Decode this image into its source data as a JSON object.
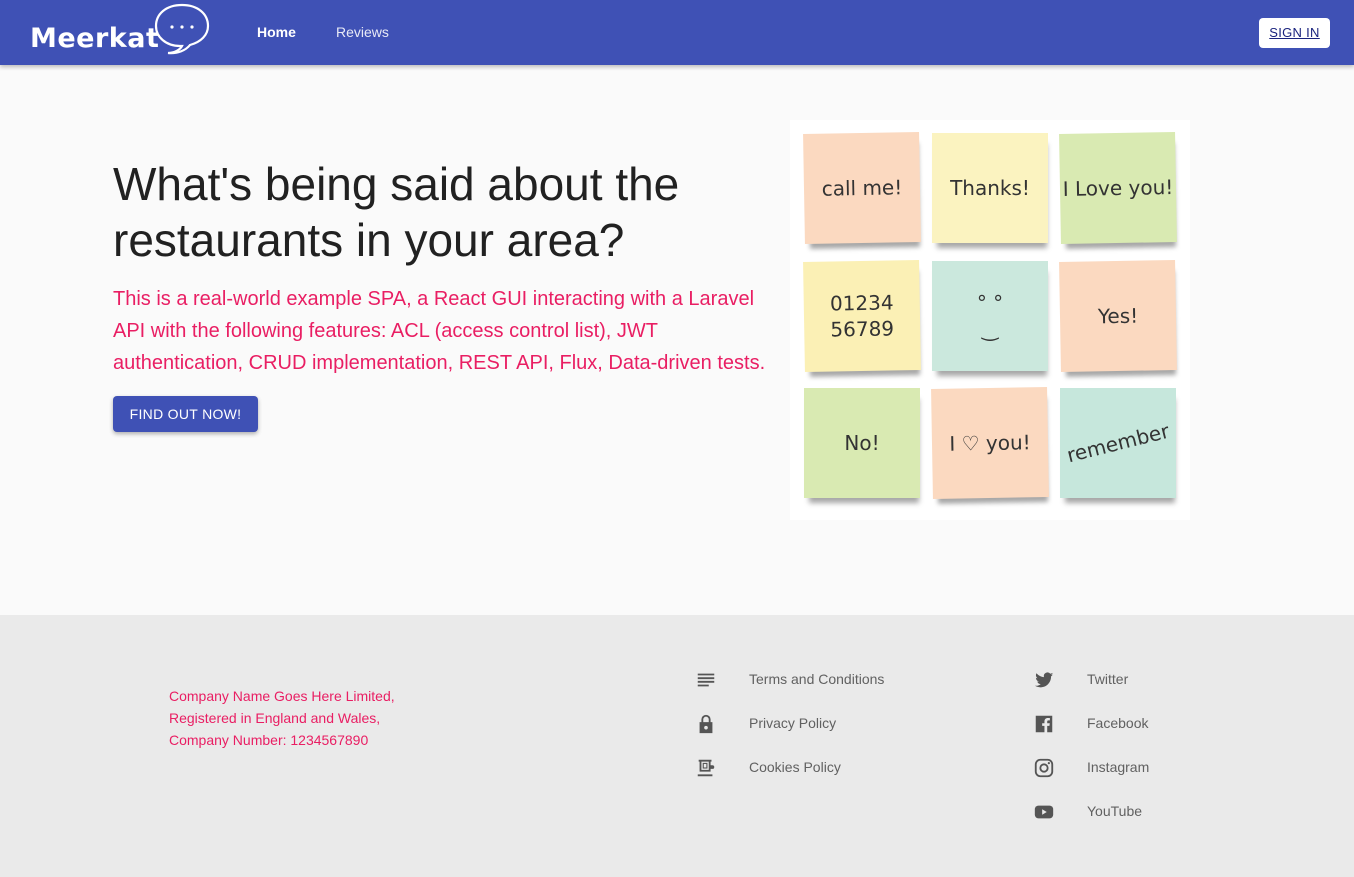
{
  "header": {
    "logo_text": "Meerkat",
    "nav": [
      {
        "label": "Home"
      },
      {
        "label": "Reviews"
      }
    ],
    "signin_label": "SIGN IN",
    "color": "#3f51b5"
  },
  "hero": {
    "title": "What's being said about the restaurants in your area?",
    "description": "This is a real-world example SPA, a React GUI interacting with a Laravel API with the following features: ACL (access control list), JWT authentication, CRUD implementation, REST API, Flux, Data-driven tests.",
    "cta_label": "FIND OUT NOW!",
    "description_color": "#e91e63"
  },
  "notes": [
    {
      "text": "call me!",
      "color": "#fbd9c0"
    },
    {
      "text": "Thanks!",
      "color": "#fbf3c0"
    },
    {
      "text": "I Love you!",
      "color": "#d9eab2"
    },
    {
      "text": "01234\n56789",
      "color": "#fbf0b5"
    },
    {
      "text": "° °\n‿",
      "color": "#cbe8dd"
    },
    {
      "text": "Yes!",
      "color": "#fbd9c0"
    },
    {
      "text": "No!",
      "color": "#d9eab2"
    },
    {
      "text": "I ♡ you!",
      "color": "#fbd9c0"
    },
    {
      "text": "remember",
      "color": "#c6e7dc"
    }
  ],
  "footer": {
    "company_lines": [
      "Company Name Goes Here Limited,",
      "Registered in England and Wales,",
      "Company Number: 1234567890"
    ],
    "policy_links": [
      {
        "label": "Terms and Conditions",
        "icon": "notes-icon"
      },
      {
        "label": "Privacy Policy",
        "icon": "lock-icon"
      },
      {
        "label": "Cookies Policy",
        "icon": "coffee-icon"
      }
    ],
    "social_links": [
      {
        "label": "Twitter",
        "icon": "twitter-icon"
      },
      {
        "label": "Facebook",
        "icon": "facebook-icon"
      },
      {
        "label": "Instagram",
        "icon": "instagram-icon"
      },
      {
        "label": "YouTube",
        "icon": "youtube-icon"
      }
    ]
  }
}
